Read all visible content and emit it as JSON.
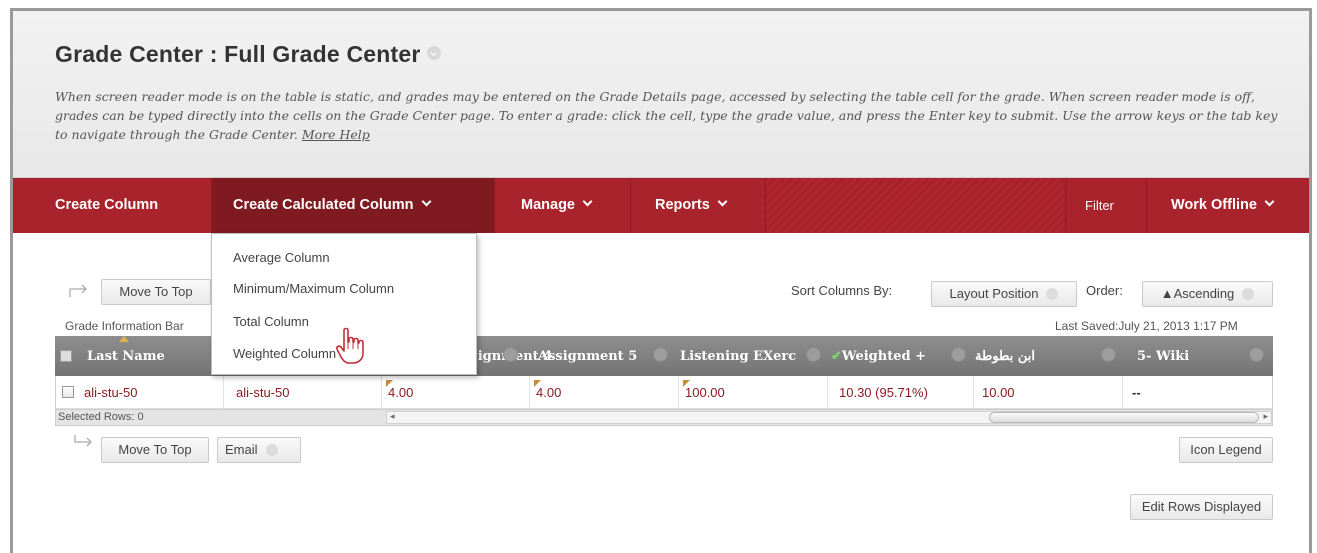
{
  "header": {
    "title": "Grade Center : Full Grade Center",
    "instructions": "When screen reader mode is on the table is static, and grades may be entered on the Grade Details page, accessed by selecting the table cell for the grade. When screen reader mode is off, grades can be typed directly into the cells on the Grade Center page. To enter a grade: click the cell, type the grade value, and press the Enter key to submit. Use the arrow keys or the tab key to navigate through the Grade Center.",
    "more_help": "More Help"
  },
  "nav": {
    "create_column": "Create Column",
    "create_calculated_column": "Create Calculated Column",
    "manage": "Manage",
    "reports": "Reports",
    "filter": "Filter",
    "work_offline": "Work Offline",
    "accent_color": "#a8232b"
  },
  "dropdown": {
    "items": [
      "Average Column",
      "Minimum/Maximum Column",
      "Total Column",
      "Weighted Column"
    ]
  },
  "toolbar": {
    "move_to_top": "Move To Top",
    "email": "Email",
    "sort_columns_by_label": "Sort Columns By:",
    "sort_value": "Layout Position",
    "order_label": "Order:",
    "order_value": "▲Ascending",
    "grade_info_bar": "Grade Information Bar",
    "last_saved": "Last Saved:July 21, 2013 1:17 PM"
  },
  "grid": {
    "columns": [
      "Last Name",
      "Assignment 4",
      "Assignment 5",
      "Listening EXerc",
      "Weighted +",
      "ابن بطوطة",
      "5- Wiki"
    ],
    "weighted_column_check": "✔",
    "row": {
      "last_name": "ali-stu-50",
      "first_name": "ali-stu-50",
      "assignment4": "4.00",
      "assignment5": "4.00",
      "listening": "100.00",
      "weighted": "10.30 (95.71%)",
      "ibn_battuta": "10.00",
      "wiki": "--"
    },
    "selected_rows": "Selected Rows: 0"
  },
  "bottom": {
    "move_to_top": "Move To Top",
    "email": "Email",
    "icon_legend": "Icon Legend",
    "edit_rows_displayed": "Edit Rows Displayed"
  }
}
